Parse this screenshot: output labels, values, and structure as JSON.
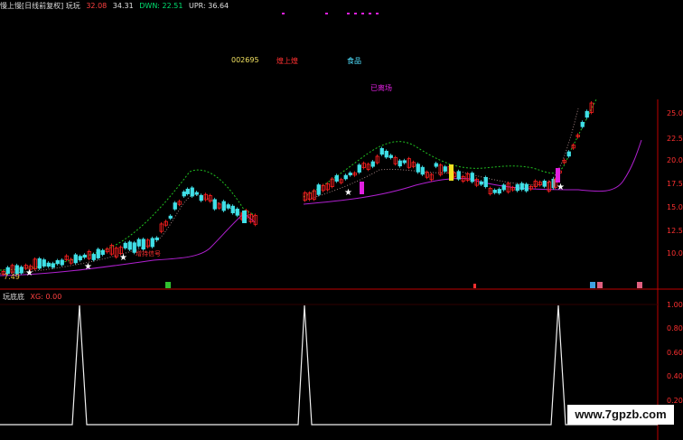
{
  "header": {
    "title": "慢上慢[日线前复权] 玩玩",
    "value1": "32.08",
    "value2": "34.31",
    "dwn": "DWN: 22.51",
    "upr": "UPR: 36.64"
  },
  "stock": {
    "code": "002695",
    "name": "煌上煌",
    "sector": "食品",
    "tag": "已离场"
  },
  "low_label": "7.49",
  "sub_panel": {
    "title": "玩底底",
    "xg": "XG: 0.00"
  },
  "price_axis": [
    "25.00",
    "22.50",
    "20.00",
    "17.50",
    "15.00",
    "12.50",
    "10.00"
  ],
  "indicator_axis": [
    "1.00",
    "0.80",
    "0.60",
    "0.40",
    "0.20"
  ],
  "watermark": "www.7gpzb.com",
  "colors": {
    "up": "#ff2020",
    "down": "#40e0e8",
    "upper_band": "#20c020",
    "lower_band": "#b020d0",
    "axis": "#c00000"
  }
}
